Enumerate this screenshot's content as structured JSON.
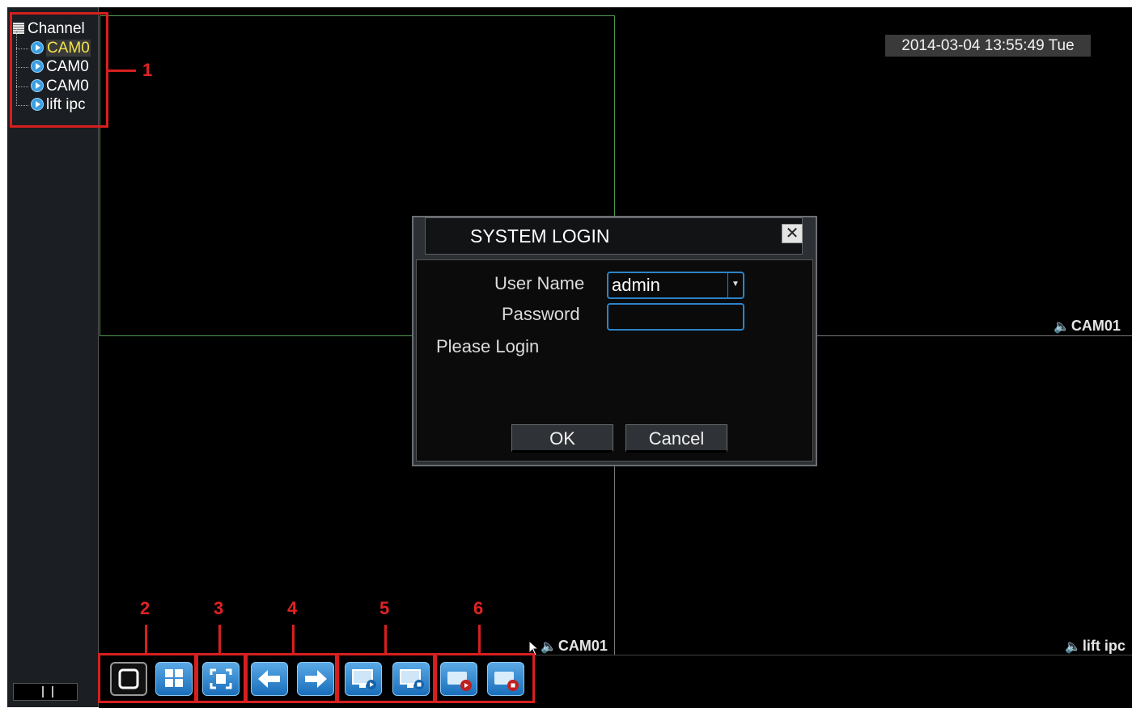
{
  "sidebar": {
    "root_label": "Channel",
    "channels": [
      "CAM0",
      "CAM0",
      "CAM0",
      "lift ipc"
    ]
  },
  "datetime": "2014-03-04 13:55:49 Tue",
  "camera_labels": {
    "top_right": "CAM01",
    "bottom_left": "CAM01",
    "bottom_right": "lift ipc"
  },
  "login_dialog": {
    "title": "SYSTEM LOGIN",
    "close_glyph": "✕",
    "username_label": "User Name",
    "username_value": "admin",
    "password_label": "Password",
    "password_value": "",
    "status": "Please Login",
    "ok_label": "OK",
    "cancel_label": "Cancel"
  },
  "annotations": [
    "1",
    "2",
    "3",
    "4",
    "5",
    "6"
  ],
  "toolbar": {
    "items": [
      {
        "name": "single-view-icon"
      },
      {
        "name": "quad-view-icon"
      },
      {
        "name": "fullscreen-icon"
      },
      {
        "name": "previous-arrow-icon"
      },
      {
        "name": "next-arrow-icon"
      },
      {
        "name": "start-preview-icon"
      },
      {
        "name": "stop-preview-icon"
      },
      {
        "name": "start-record-icon"
      },
      {
        "name": "stop-record-icon"
      }
    ]
  },
  "colors": {
    "annotation": "#d71f1f",
    "selected_grid": "#5aa05a",
    "field_border": "#2c84c8"
  }
}
